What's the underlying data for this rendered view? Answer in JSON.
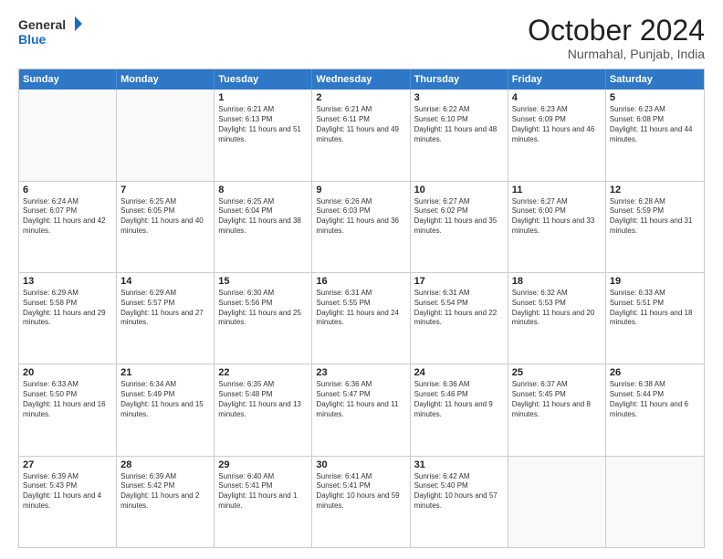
{
  "header": {
    "logo_general": "General",
    "logo_blue": "Blue",
    "month_title": "October 2024",
    "location": "Nurmahal, Punjab, India"
  },
  "weekdays": [
    "Sunday",
    "Monday",
    "Tuesday",
    "Wednesday",
    "Thursday",
    "Friday",
    "Saturday"
  ],
  "rows": [
    [
      {
        "day": "",
        "info": ""
      },
      {
        "day": "",
        "info": ""
      },
      {
        "day": "1",
        "info": "Sunrise: 6:21 AM\nSunset: 6:13 PM\nDaylight: 11 hours and 51 minutes."
      },
      {
        "day": "2",
        "info": "Sunrise: 6:21 AM\nSunset: 6:11 PM\nDaylight: 11 hours and 49 minutes."
      },
      {
        "day": "3",
        "info": "Sunrise: 6:22 AM\nSunset: 6:10 PM\nDaylight: 11 hours and 48 minutes."
      },
      {
        "day": "4",
        "info": "Sunrise: 6:23 AM\nSunset: 6:09 PM\nDaylight: 11 hours and 46 minutes."
      },
      {
        "day": "5",
        "info": "Sunrise: 6:23 AM\nSunset: 6:08 PM\nDaylight: 11 hours and 44 minutes."
      }
    ],
    [
      {
        "day": "6",
        "info": "Sunrise: 6:24 AM\nSunset: 6:07 PM\nDaylight: 11 hours and 42 minutes."
      },
      {
        "day": "7",
        "info": "Sunrise: 6:25 AM\nSunset: 6:05 PM\nDaylight: 11 hours and 40 minutes."
      },
      {
        "day": "8",
        "info": "Sunrise: 6:25 AM\nSunset: 6:04 PM\nDaylight: 11 hours and 38 minutes."
      },
      {
        "day": "9",
        "info": "Sunrise: 6:26 AM\nSunset: 6:03 PM\nDaylight: 11 hours and 36 minutes."
      },
      {
        "day": "10",
        "info": "Sunrise: 6:27 AM\nSunset: 6:02 PM\nDaylight: 11 hours and 35 minutes."
      },
      {
        "day": "11",
        "info": "Sunrise: 6:27 AM\nSunset: 6:00 PM\nDaylight: 11 hours and 33 minutes."
      },
      {
        "day": "12",
        "info": "Sunrise: 6:28 AM\nSunset: 5:59 PM\nDaylight: 11 hours and 31 minutes."
      }
    ],
    [
      {
        "day": "13",
        "info": "Sunrise: 6:29 AM\nSunset: 5:58 PM\nDaylight: 11 hours and 29 minutes."
      },
      {
        "day": "14",
        "info": "Sunrise: 6:29 AM\nSunset: 5:57 PM\nDaylight: 11 hours and 27 minutes."
      },
      {
        "day": "15",
        "info": "Sunrise: 6:30 AM\nSunset: 5:56 PM\nDaylight: 11 hours and 25 minutes."
      },
      {
        "day": "16",
        "info": "Sunrise: 6:31 AM\nSunset: 5:55 PM\nDaylight: 11 hours and 24 minutes."
      },
      {
        "day": "17",
        "info": "Sunrise: 6:31 AM\nSunset: 5:54 PM\nDaylight: 11 hours and 22 minutes."
      },
      {
        "day": "18",
        "info": "Sunrise: 6:32 AM\nSunset: 5:53 PM\nDaylight: 11 hours and 20 minutes."
      },
      {
        "day": "19",
        "info": "Sunrise: 6:33 AM\nSunset: 5:51 PM\nDaylight: 11 hours and 18 minutes."
      }
    ],
    [
      {
        "day": "20",
        "info": "Sunrise: 6:33 AM\nSunset: 5:50 PM\nDaylight: 11 hours and 16 minutes."
      },
      {
        "day": "21",
        "info": "Sunrise: 6:34 AM\nSunset: 5:49 PM\nDaylight: 11 hours and 15 minutes."
      },
      {
        "day": "22",
        "info": "Sunrise: 6:35 AM\nSunset: 5:48 PM\nDaylight: 11 hours and 13 minutes."
      },
      {
        "day": "23",
        "info": "Sunrise: 6:36 AM\nSunset: 5:47 PM\nDaylight: 11 hours and 11 minutes."
      },
      {
        "day": "24",
        "info": "Sunrise: 6:36 AM\nSunset: 5:46 PM\nDaylight: 11 hours and 9 minutes."
      },
      {
        "day": "25",
        "info": "Sunrise: 6:37 AM\nSunset: 5:45 PM\nDaylight: 11 hours and 8 minutes."
      },
      {
        "day": "26",
        "info": "Sunrise: 6:38 AM\nSunset: 5:44 PM\nDaylight: 11 hours and 6 minutes."
      }
    ],
    [
      {
        "day": "27",
        "info": "Sunrise: 6:39 AM\nSunset: 5:43 PM\nDaylight: 11 hours and 4 minutes."
      },
      {
        "day": "28",
        "info": "Sunrise: 6:39 AM\nSunset: 5:42 PM\nDaylight: 11 hours and 2 minutes."
      },
      {
        "day": "29",
        "info": "Sunrise: 6:40 AM\nSunset: 5:41 PM\nDaylight: 11 hours and 1 minute."
      },
      {
        "day": "30",
        "info": "Sunrise: 6:41 AM\nSunset: 5:41 PM\nDaylight: 10 hours and 59 minutes."
      },
      {
        "day": "31",
        "info": "Sunrise: 6:42 AM\nSunset: 5:40 PM\nDaylight: 10 hours and 57 minutes."
      },
      {
        "day": "",
        "info": ""
      },
      {
        "day": "",
        "info": ""
      }
    ]
  ]
}
